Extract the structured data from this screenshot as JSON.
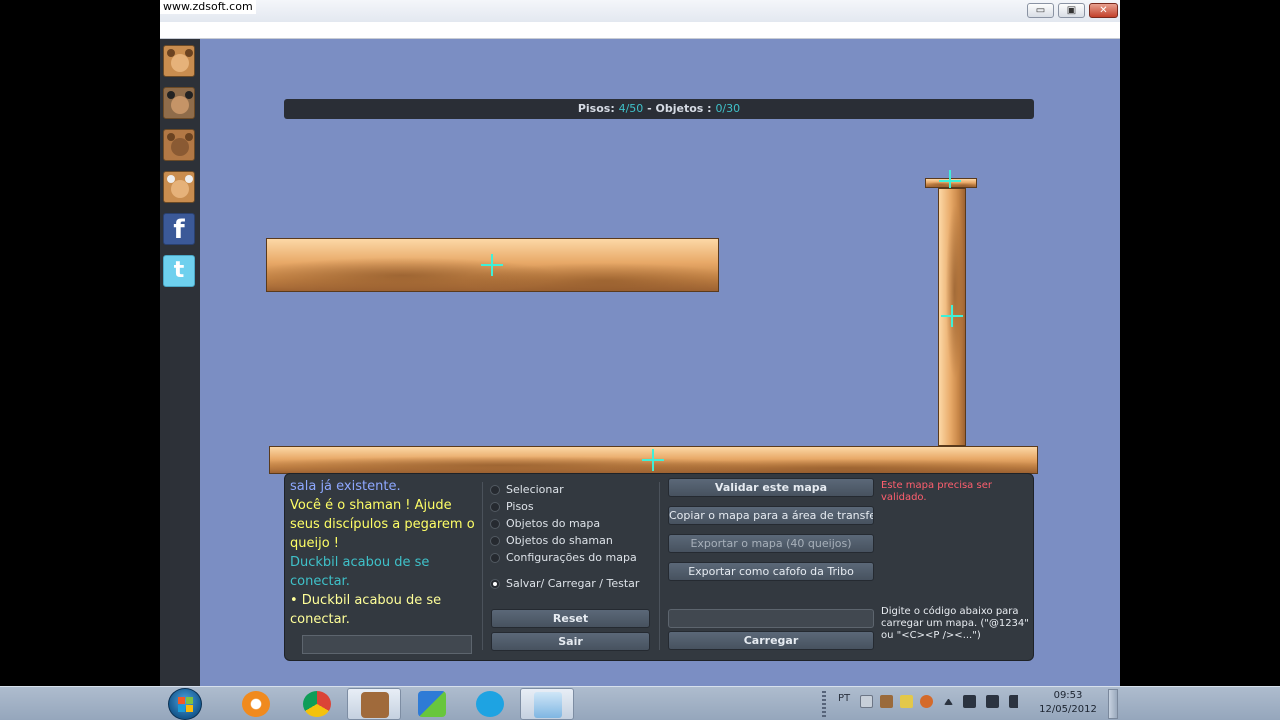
{
  "watermark": "www.zdsoft.com",
  "window_controls": {
    "minimize": "▭",
    "maximize": "▣",
    "close": "✕"
  },
  "sidebar": {
    "items": [
      {
        "name": "avatar-1"
      },
      {
        "name": "avatar-2"
      },
      {
        "name": "avatar-3"
      },
      {
        "name": "avatar-4"
      },
      {
        "name": "facebook",
        "glyph": "f"
      },
      {
        "name": "twitter",
        "glyph": "t"
      }
    ]
  },
  "infobar": {
    "pisos_label": "Pisos:",
    "pisos_value": "4/50",
    "separator": " - ",
    "objetos_label": "Objetos :",
    "objetos_value": "0/30"
  },
  "chat": {
    "lines": [
      {
        "text": "sala já existente.",
        "color": "#8ea8ff"
      },
      {
        "text": "Você é o shaman ! Ajude seus discípulos a pegarem o queijo !",
        "color": "#ffff66"
      },
      {
        "text": "Duckbil acabou de se conectar.",
        "color": "#3fc1c9"
      },
      {
        "text": "• Duckbil acabou de se conectar.",
        "color": "#ffff99"
      }
    ]
  },
  "modes": {
    "items": [
      {
        "label": "Selecionar",
        "selected": false
      },
      {
        "label": "Pisos",
        "selected": false
      },
      {
        "label": "Objetos do mapa",
        "selected": false
      },
      {
        "label": "Objetos do shaman",
        "selected": false
      },
      {
        "label": "Configurações do mapa",
        "selected": false
      },
      {
        "label": "Salvar/ Carregar / Testar",
        "selected": true
      }
    ],
    "reset_label": "Reset",
    "sair_label": "Sair"
  },
  "actions": {
    "validar_label": "Validar este mapa",
    "copiar_label": "Copiar o mapa para a área de transferi",
    "exportar_label": "Exportar o mapa (40 queijos)",
    "exportar_tribo_label": "Exportar como cafofo da Tribo",
    "carregar_label": "Carregar",
    "validation_note": "Este mapa precisa ser validado.",
    "load_help": "Digite o código abaixo para carregar um mapa. (\"@1234\" ou \"<C><P /><...\")"
  },
  "taskbar": {
    "apps": [
      {
        "name": "media-player",
        "active": false
      },
      {
        "name": "chrome",
        "active": false
      },
      {
        "name": "transformice",
        "active": true
      },
      {
        "name": "messenger",
        "active": false
      },
      {
        "name": "skype",
        "active": false
      },
      {
        "name": "paint",
        "active": true
      }
    ],
    "language": "PT",
    "time": "09:53",
    "date": "12/05/2012"
  }
}
